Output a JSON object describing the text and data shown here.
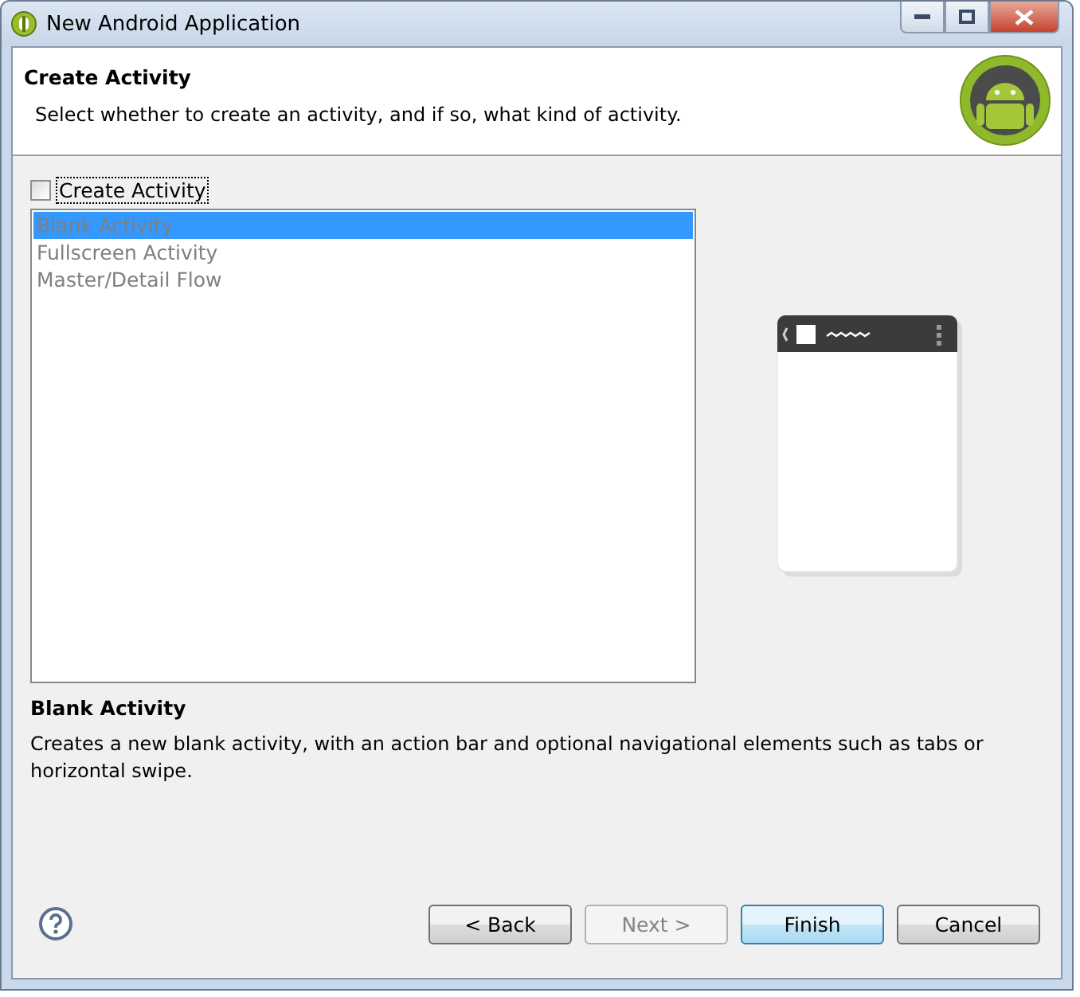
{
  "window": {
    "title": "New Android Application"
  },
  "header": {
    "title": "Create Activity",
    "description": "Select whether to create an activity, and if so, what kind of activity."
  },
  "create_activity": {
    "label": "Create Activity",
    "checked": false
  },
  "templates": {
    "disabled": true,
    "items": [
      {
        "label": "Blank Activity",
        "selected": true
      },
      {
        "label": "Fullscreen Activity",
        "selected": false
      },
      {
        "label": "Master/Detail Flow",
        "selected": false
      }
    ]
  },
  "details": {
    "title": "Blank Activity",
    "description": "Creates a new blank activity, with an action bar and optional navigational elements such as tabs or horizontal swipe."
  },
  "buttons": [
    {
      "label": "< Back",
      "disabled": false,
      "default": false
    },
    {
      "label": "Next >",
      "disabled": true,
      "default": false
    },
    {
      "label": "Finish",
      "disabled": false,
      "default": true
    },
    {
      "label": "Cancel",
      "disabled": false,
      "default": false
    }
  ]
}
